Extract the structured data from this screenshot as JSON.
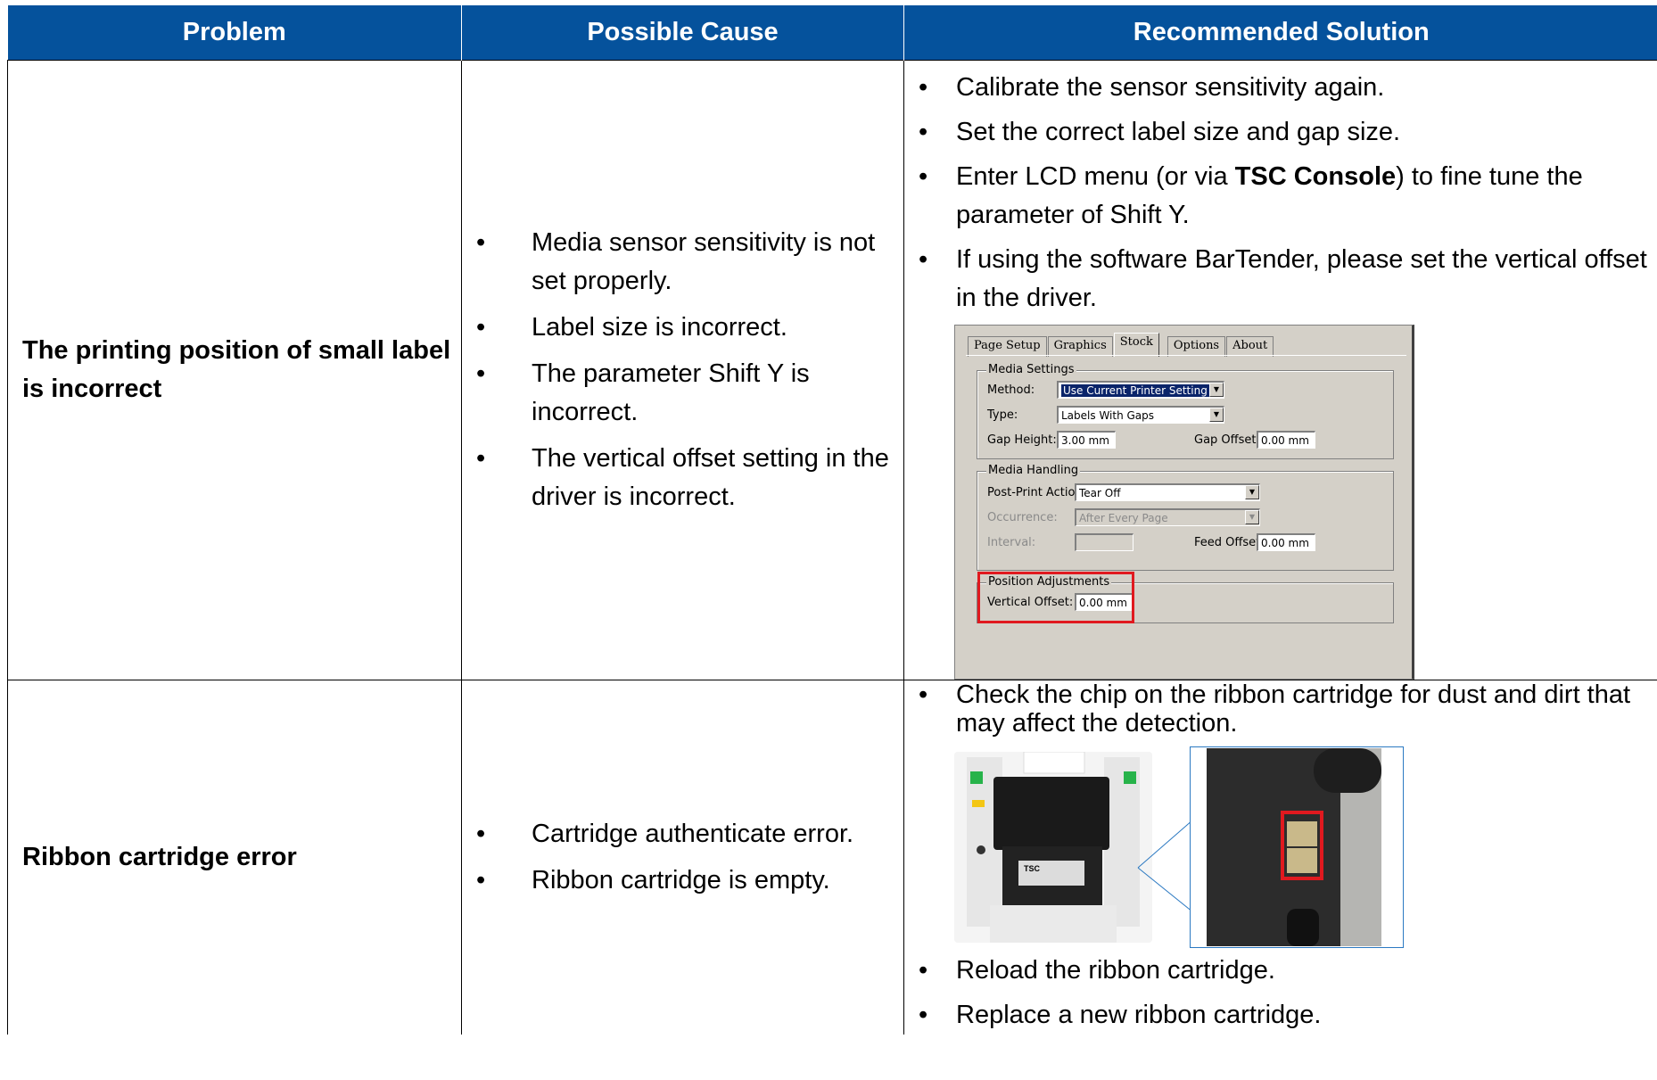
{
  "table": {
    "headers": [
      "Problem",
      "Possible Cause",
      "Recommended Solution"
    ],
    "row1": {
      "problem": "The printing position of small label is incorrect",
      "causes": [
        "Media sensor sensitivity is not set properly.",
        "Label size is incorrect.",
        "The parameter Shift Y is incorrect.",
        "The vertical offset setting in the driver is incorrect."
      ],
      "solutions": {
        "s1": "Calibrate the sensor sensitivity again.",
        "s2": "Set the correct label size and gap size.",
        "s3_pre": "Enter LCD menu (or via ",
        "s3_bold": "TSC Console",
        "s3_post": ") to fine tune the parameter of Shift Y.",
        "s4": "If using the software BarTender, please set the vertical offset in the driver."
      }
    },
    "row2": {
      "problem": "Ribbon cartridge error",
      "causes": [
        "Cartridge authenticate error.",
        "Ribbon cartridge is empty."
      ],
      "solutions": [
        "Check the chip on the ribbon cartridge for dust and dirt that may affect the detection.",
        "Reload the ribbon cartridge.",
        "Replace a new ribbon cartridge."
      ]
    }
  },
  "dialog": {
    "tabs": [
      "Page Setup",
      "Graphics",
      "Stock",
      "Options",
      "About"
    ],
    "media_settings": {
      "title": "Media Settings",
      "method_label": "Method:",
      "method_value": "Use Current Printer Setting",
      "type_label": "Type:",
      "type_value": "Labels With Gaps",
      "gap_height_label": "Gap Height:",
      "gap_height_value": "3.00 mm",
      "gap_offset_label": "Gap Offset:",
      "gap_offset_value": "0.00 mm"
    },
    "media_handling": {
      "title": "Media Handling",
      "post_print_label": "Post-Print Action:",
      "post_print_value": "Tear Off",
      "occurrence_label": "Occurrence:",
      "occurrence_value": "After Every Page",
      "interval_label": "Interval:",
      "interval_value": "",
      "feed_offset_label": "Feed Offset:",
      "feed_offset_value": "0.00 mm"
    },
    "position": {
      "title": "Position Adjustments",
      "vertical_offset_label": "Vertical Offset:",
      "vertical_offset_value": "0.00 mm"
    }
  },
  "colors": {
    "header_bg": "#05529c",
    "highlight": "#e0191f",
    "callout": "#2b79c2"
  }
}
